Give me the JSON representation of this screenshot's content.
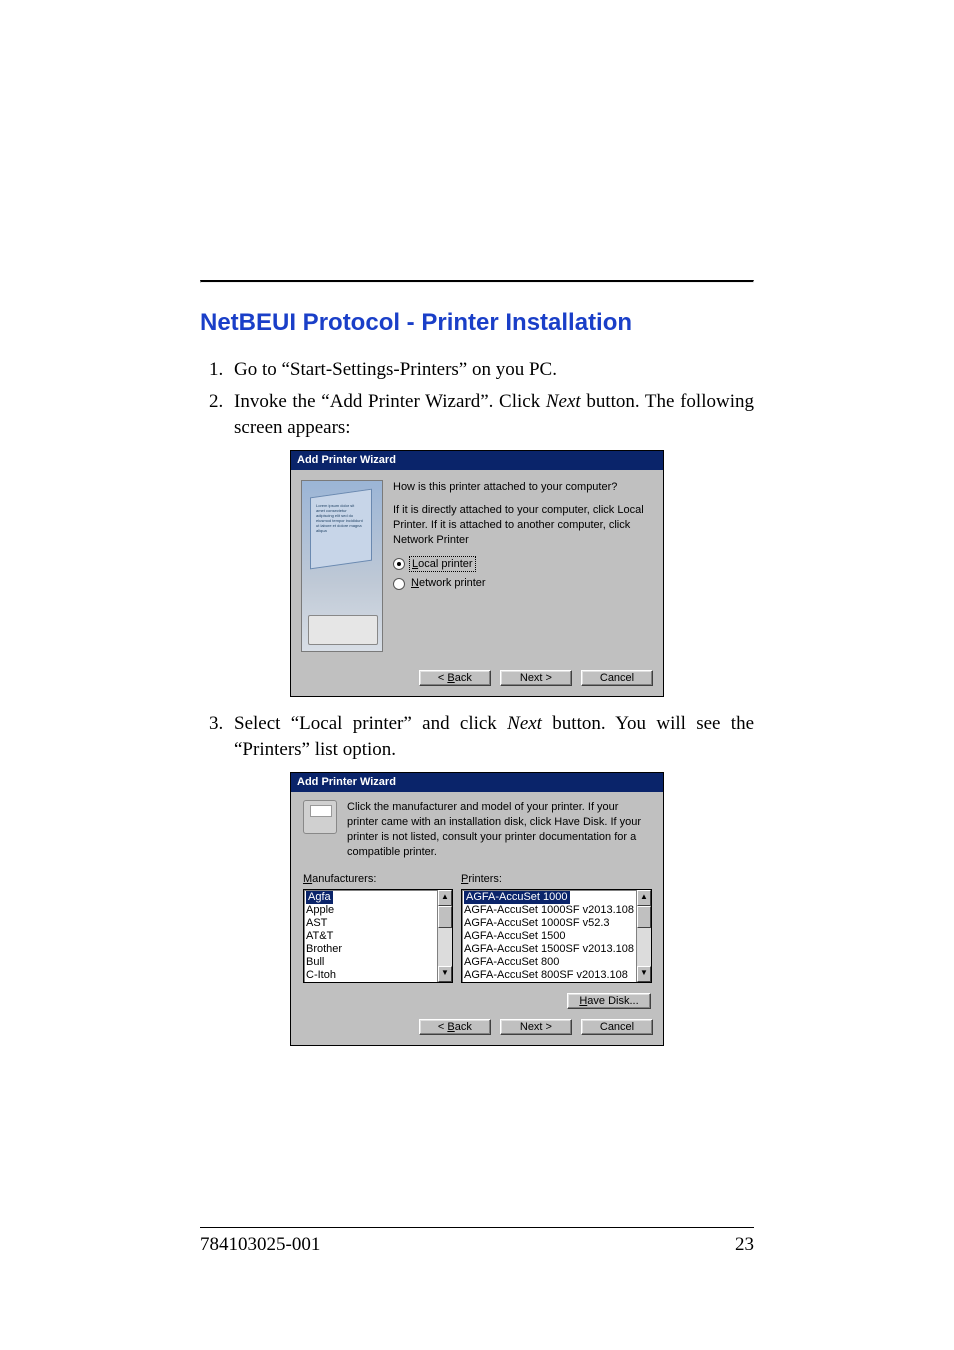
{
  "section_title": "NetBEUI Protocol - Printer Installation",
  "steps": {
    "s1": "Go to “Start-Settings-Printers” on you PC.",
    "s2_a": "Invoke the “Add Printer Wizard”. Click ",
    "s2_em": "Next",
    "s2_b": " button. The following screen appears:",
    "s3_a": "Select “Local printer” and click ",
    "s3_em": "Next",
    "s3_b": " button. You will see the “Printers” list option."
  },
  "dlg1": {
    "title": "Add Printer Wizard",
    "q": "How is this printer attached to your computer?",
    "help": "If it is directly attached to your computer, click Local Printer. If it is attached to another computer, click Network Printer",
    "radio_local_u": "L",
    "radio_local_rest": "ocal printer",
    "radio_net_u": "N",
    "radio_net_rest": "etwork printer",
    "back_u": "B",
    "back_pre": "< ",
    "back_rest": "ack",
    "next": "Next >",
    "cancel": "Cancel"
  },
  "dlg2": {
    "title": "Add Printer Wizard",
    "desc": "Click the manufacturer and model of your printer. If your printer came with an installation disk, click Have Disk. If your printer is not listed, consult your printer documentation for a compatible printer.",
    "mfg_u": "M",
    "mfg_rest": "anufacturers:",
    "prn_u": "P",
    "prn_rest": "rinters:",
    "manufacturers": [
      "Agfa",
      "Apple",
      "AST",
      "AT&T",
      "Brother",
      "Bull",
      "C-Itoh"
    ],
    "printers": [
      "AGFA-AccuSet 1000",
      "AGFA-AccuSet 1000SF v2013.108",
      "AGFA-AccuSet 1000SF v52.3",
      "AGFA-AccuSet 1500",
      "AGFA-AccuSet 1500SF v2013.108",
      "AGFA-AccuSet 800",
      "AGFA-AccuSet 800SF v2013.108"
    ],
    "have_u": "H",
    "have_rest": "ave Disk...",
    "back_u": "B",
    "back_pre": "< ",
    "back_rest": "ack",
    "next": "Next >",
    "cancel": "Cancel"
  },
  "footer": {
    "doc_number": "784103025-001",
    "page_number": "23"
  }
}
